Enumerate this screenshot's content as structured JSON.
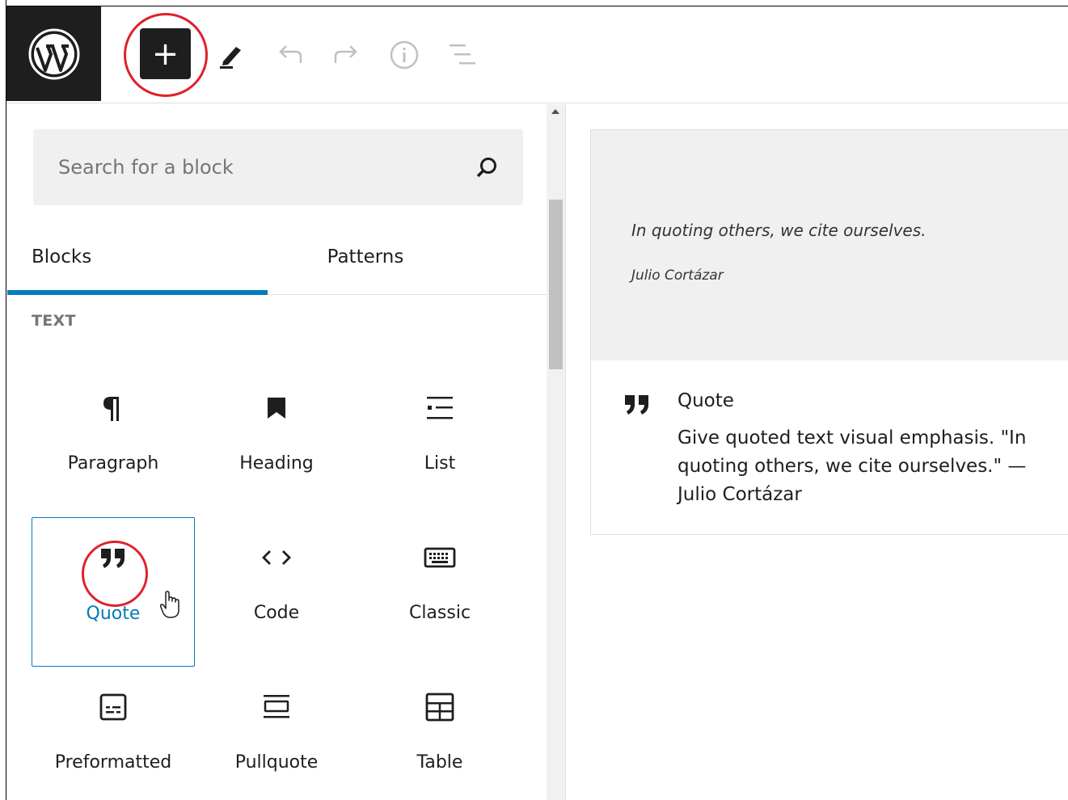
{
  "toolbar": {
    "logo_name": "wordpress-logo",
    "add_label": "+",
    "tools": [
      "edit-icon",
      "undo-icon",
      "redo-icon",
      "info-icon",
      "list-view-icon"
    ]
  },
  "inserter": {
    "search": {
      "placeholder": "Search for a block"
    },
    "tabs": {
      "blocks": "Blocks",
      "patterns": "Patterns"
    },
    "section_title": "TEXT",
    "blocks": [
      {
        "label": "Paragraph",
        "icon": "paragraph-icon"
      },
      {
        "label": "Heading",
        "icon": "heading-icon"
      },
      {
        "label": "List",
        "icon": "list-icon"
      },
      {
        "label": "Quote",
        "icon": "quote-icon"
      },
      {
        "label": "Code",
        "icon": "code-icon"
      },
      {
        "label": "Classic",
        "icon": "classic-icon"
      },
      {
        "label": "Preformatted",
        "icon": "preformatted-icon"
      },
      {
        "label": "Pullquote",
        "icon": "pullquote-icon"
      },
      {
        "label": "Table",
        "icon": "table-icon"
      }
    ],
    "selected_block": "Quote"
  },
  "preview": {
    "quote_text": "In quoting others, we cite ourselves.",
    "cite": "Julio Cortázar",
    "title": "Quote",
    "description": "Give quoted text visual emphasis. \"In quoting others, we cite ourselves.\" — Julio Cortázar"
  },
  "colors": {
    "accent": "#007cba",
    "dark": "#1e1e1e",
    "highlight_ring": "#e0202a"
  }
}
